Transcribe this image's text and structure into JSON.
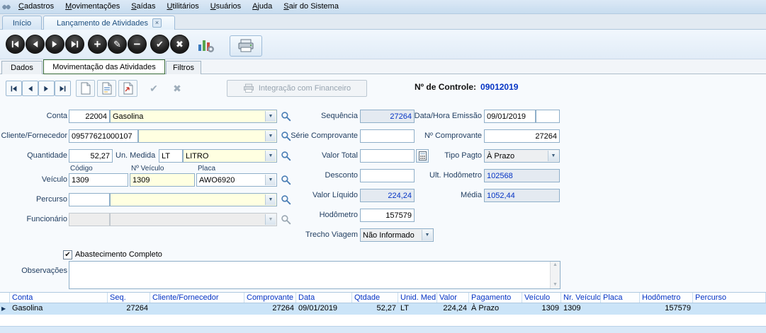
{
  "menubar": {
    "items": [
      "Cadastros",
      "Movimentações",
      "Saídas",
      "Utilitários",
      "Usuários",
      "Ajuda",
      "Sair do Sistema"
    ]
  },
  "tabbar": {
    "tabs": [
      {
        "label": "Início"
      },
      {
        "label": "Lançamento de Atividades",
        "closable": true
      }
    ]
  },
  "subtabs": {
    "tabs": [
      "Dados",
      "Movimentação das Atividades",
      "Filtros"
    ]
  },
  "record_toolbar": {
    "integration_label": "Integração com Financeiro",
    "control_label": "Nº de Controle:",
    "control_value": "09012019"
  },
  "form": {
    "conta": {
      "label": "Conta",
      "code": "22004",
      "name": "Gasolina"
    },
    "cliente_fornecedor": {
      "label": "Cliente/Fornecedor",
      "code": "09577621000107",
      "name": ""
    },
    "quantidade": {
      "label": "Quantidade",
      "value": "52,27"
    },
    "un_medida": {
      "label": "Un. Medida",
      "code": "LT",
      "name": "LITRO"
    },
    "veiculo": {
      "label": "Veículo",
      "col_codigo": "Código",
      "col_nr_veiculo": "Nº Veículo",
      "col_placa": "Placa",
      "codigo": "1309",
      "nr_veiculo": "1309",
      "placa": "AWO6920"
    },
    "percurso": {
      "label": "Percurso",
      "code": "",
      "name": ""
    },
    "funcionario": {
      "label": "Funcionário",
      "code": "",
      "name": ""
    },
    "sequencia": {
      "label": "Sequência",
      "value": "27264"
    },
    "serie_comprovante": {
      "label": "Série Comprovante",
      "value": ""
    },
    "valor_total": {
      "label": "Valor Total",
      "value": ""
    },
    "desconto": {
      "label": "Desconto",
      "value": ""
    },
    "valor_liquido": {
      "label": "Valor Líquido",
      "value": "224,24"
    },
    "hodometro": {
      "label": "Hodômetro",
      "value": "157579"
    },
    "trecho_viagem": {
      "label": "Trecho Viagem",
      "value": "Não Informado"
    },
    "data_hora_emissao": {
      "label": "Data/Hora Emissão",
      "date": "09/01/2019",
      "time": ""
    },
    "nr_comprovante": {
      "label": "Nº Comprovante",
      "value": "27264"
    },
    "tipo_pagto": {
      "label": "Tipo Pagto",
      "value": "À Prazo"
    },
    "ult_hodometro": {
      "label": "Ult. Hodômetro",
      "value": "102568"
    },
    "media": {
      "label": "Média",
      "value": "1052,44"
    },
    "abastecimento_completo": {
      "label": "Abastecimento Completo",
      "checked": true
    },
    "observacoes": {
      "label": "Observações",
      "value": ""
    }
  },
  "grid": {
    "columns": [
      "Conta",
      "Seq.",
      "Cliente/Fornecedor",
      "Comprovante",
      "Data",
      "Qtdade",
      "Unid. Med.",
      "Valor",
      "Pagamento",
      "Veículo",
      "Nr. Veículo",
      "Placa",
      "Hodômetro",
      "Percurso"
    ],
    "row": [
      "Gasolina",
      "27264",
      "",
      "27264",
      "09/01/2019",
      "52,27",
      "LT",
      "224,24",
      "À Prazo",
      "1309",
      "1309",
      "",
      "157579",
      ""
    ]
  },
  "icons": {
    "dropdown_arrow": "▼",
    "scroll_up": "▲",
    "scroll_down": "▼",
    "check": "✔",
    "cross": "✖",
    "pencil": "✎",
    "plus": "+",
    "minus": "−",
    "close": "×",
    "row_marker": "▶",
    "checkbox_check": "✔"
  },
  "colors": {
    "accent_blue": "#0433C4",
    "field_yellow": "#FFFFE1",
    "readonly_field": "#E4EAF1",
    "selected_row": "#CBE4F8",
    "chrome_blue": "#DCE9F6"
  }
}
